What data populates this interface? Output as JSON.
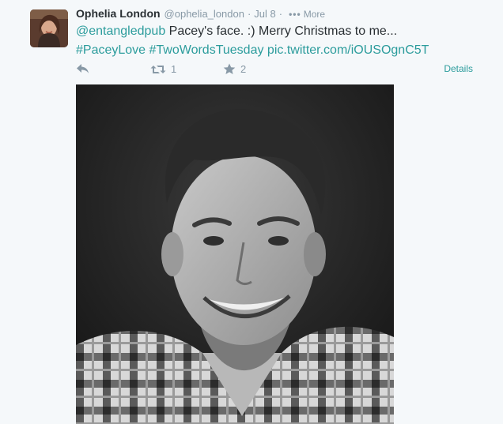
{
  "tweet": {
    "fullname": "Ophelia London",
    "username": "@ophelia_london",
    "separator": "·",
    "time": "Jul 8",
    "more_label": "More",
    "text": {
      "mention": "@entangledpub",
      "body": " Pacey's face. :) Merry Christmas to me...",
      "hashtag1": "#PaceyLove",
      "hashtag2": "#TwoWordsTuesday",
      "pic_link": "pic.twitter.com/iOUSOgnC5T"
    },
    "actions": {
      "retweet_count": "1",
      "favorite_count": "2",
      "details_label": "Details"
    }
  },
  "colors": {
    "link": "#2b9c9c",
    "muted": "#8899a6",
    "text": "#292f33",
    "background": "#f5f8fa"
  }
}
